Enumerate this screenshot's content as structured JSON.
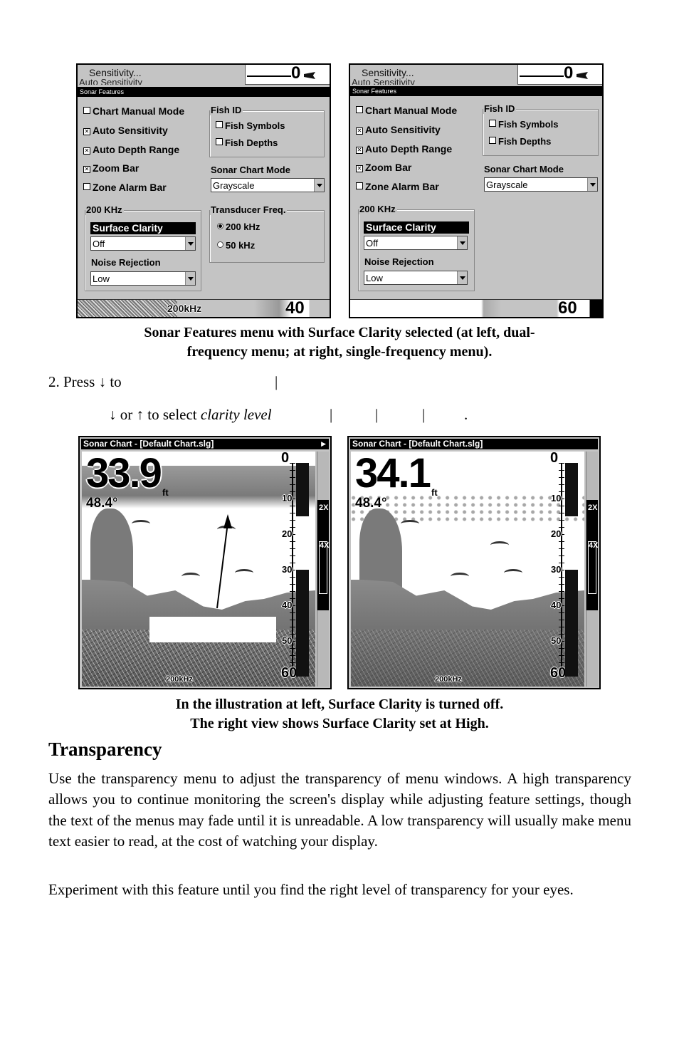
{
  "menus": [
    {
      "id": "dual-frequency",
      "top_label": "Sensitivity...",
      "top_cut_label": "Auto Sensitivity",
      "top_depth": "0",
      "title": "Sonar Features",
      "checkboxes": [
        {
          "label": "Chart Manual Mode",
          "checked": false
        },
        {
          "label": "Auto Sensitivity",
          "checked": true
        },
        {
          "label": "Auto Depth Range",
          "checked": true
        },
        {
          "label": "Zoom Bar",
          "checked": true
        },
        {
          "label": "Zone Alarm Bar",
          "checked": false
        }
      ],
      "fish_id": {
        "label": "Fish ID",
        "options": [
          {
            "label": "Fish Symbols",
            "checked": false
          },
          {
            "label": "Fish Depths",
            "checked": false
          }
        ]
      },
      "sonar_chart_mode": {
        "label": "Sonar Chart Mode",
        "value": "Grayscale"
      },
      "freq_group": {
        "label": "200 KHz",
        "surface_clarity": {
          "label": "Surface Clarity",
          "value": "Off"
        },
        "noise_rejection": {
          "label": "Noise Rejection",
          "value": "Low"
        }
      },
      "transducer_freq": {
        "label": "Transducer Freq.",
        "options": [
          {
            "label": "200 kHz",
            "selected": true
          },
          {
            "label": "50 kHz",
            "selected": false
          }
        ]
      },
      "bottom_freq": "200kHz",
      "bottom_depth": "40"
    },
    {
      "id": "single-frequency",
      "top_label": "Sensitivity...",
      "top_cut_label": "Auto Sensitivity",
      "top_depth": "0",
      "title": "Sonar Features",
      "checkboxes": [
        {
          "label": "Chart Manual Mode",
          "checked": false
        },
        {
          "label": "Auto Sensitivity",
          "checked": true
        },
        {
          "label": "Auto Depth Range",
          "checked": true
        },
        {
          "label": "Zoom Bar",
          "checked": true
        },
        {
          "label": "Zone Alarm Bar",
          "checked": false
        }
      ],
      "fish_id": {
        "label": "Fish ID",
        "options": [
          {
            "label": "Fish Symbols",
            "checked": false
          },
          {
            "label": "Fish Depths",
            "checked": false
          }
        ]
      },
      "sonar_chart_mode": {
        "label": "Sonar Chart Mode",
        "value": "Grayscale"
      },
      "freq_group": {
        "label": "200 KHz",
        "surface_clarity": {
          "label": "Surface Clarity",
          "value": "Off"
        },
        "noise_rejection": {
          "label": "Noise Rejection",
          "value": "Low"
        }
      },
      "bottom_depth": "60"
    }
  ],
  "caption1": {
    "line1": "Sonar Features menu with Surface Clarity selected (at left, dual-",
    "line2": "frequency menu; at right, single-frequency menu)."
  },
  "steps": {
    "line1_prefix": "2. Press ",
    "line1_arrow": "↓",
    "line1_text": " to",
    "line2_down": "↓",
    "line2_or": " or ",
    "line2_up": "↑",
    "line2_text": " to select ",
    "line2_italic": "clarity level",
    "separator": "|",
    "period": "."
  },
  "charts": [
    {
      "id": "surface-clarity-off",
      "title": "Sonar Chart - [Default Chart.slg]",
      "depth": "33.9",
      "unit": "ft",
      "temperature": "48.4°",
      "scale_labels": [
        "0",
        "10",
        "20",
        "30",
        "40",
        "50",
        "60"
      ],
      "zoom_labels": [
        "2X",
        "4X"
      ],
      "frequency": "200kHz"
    },
    {
      "id": "surface-clarity-high",
      "title": "Sonar Chart - [Default Chart.slg]",
      "depth": "34.1",
      "unit": "ft",
      "temperature": "48.4°",
      "scale_labels": [
        "0",
        "10",
        "20",
        "30",
        "40",
        "50",
        "60"
      ],
      "zoom_labels": [
        "2X",
        "4X"
      ],
      "frequency": "200kHz"
    }
  ],
  "caption2": {
    "line1": "In the illustration at left, Surface Clarity is turned off.",
    "line2": "The right view shows Surface Clarity set at High."
  },
  "section": {
    "heading": "Transparency",
    "paragraphs": [
      "Use the transparency menu to adjust the transparency of menu windows. A high transparency allows you to continue monitoring the screen's display while adjusting feature settings, though the text of the menus may fade until it is unreadable. A low transparency will usually make menu text easier to read, at the cost of watching your display.",
      "Experiment with this feature until you find the right level of transparency for your eyes."
    ]
  }
}
